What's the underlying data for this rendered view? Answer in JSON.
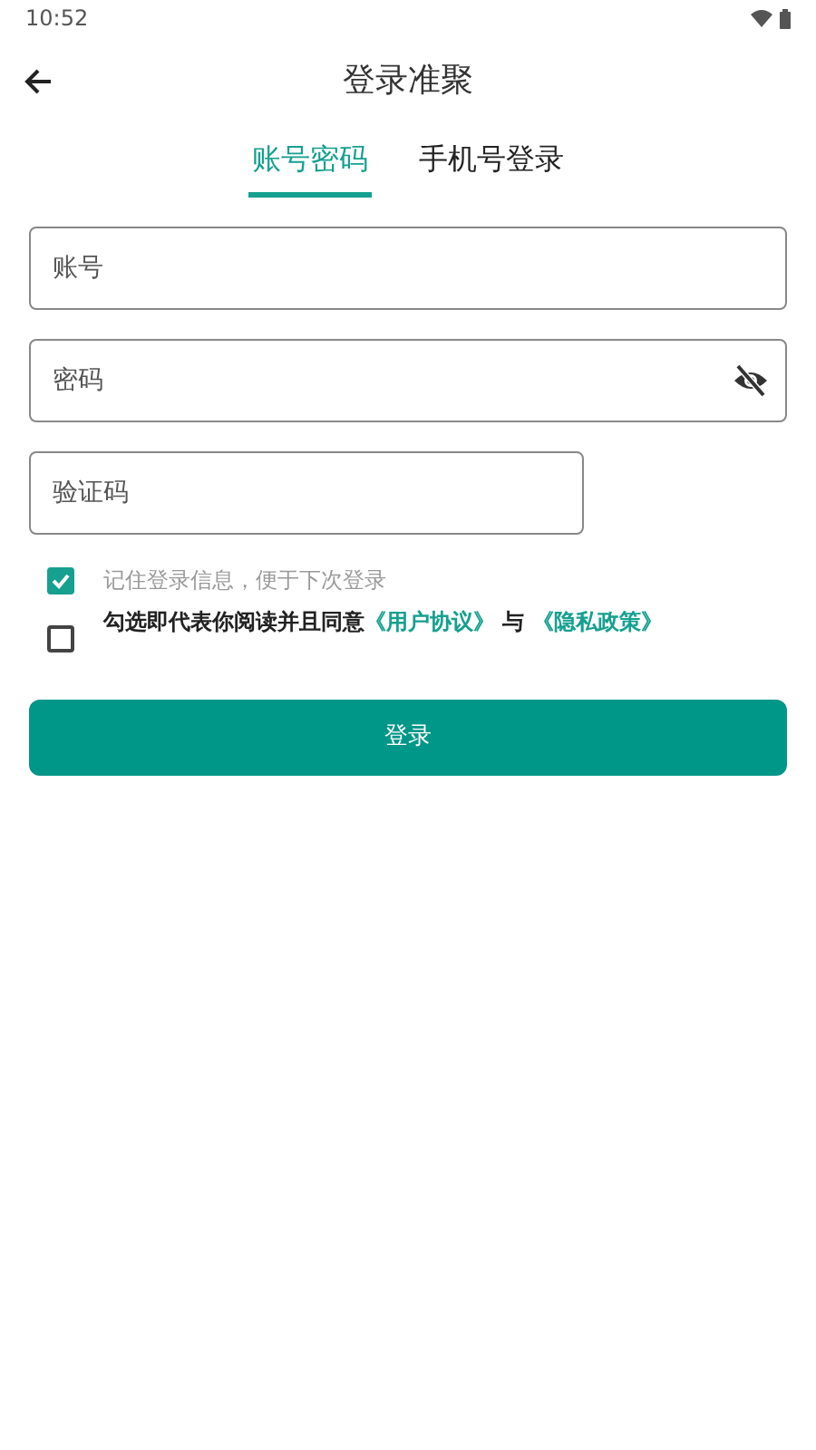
{
  "status_bar": {
    "time": "10:52"
  },
  "header": {
    "title": "登录准聚"
  },
  "tabs": [
    {
      "label": "账号密码",
      "selected": true
    },
    {
      "label": "手机号登录",
      "selected": false
    }
  ],
  "fields": [
    {
      "kind": "text",
      "placeholder": "账号"
    },
    {
      "kind": "password",
      "placeholder": "密码"
    },
    {
      "kind": "captcha",
      "placeholder": "验证码"
    }
  ],
  "remember": {
    "label": "记住登录信息，便于下次登录",
    "checked": true
  },
  "agreement": {
    "checked": false,
    "text": "勾选即代表你阅读并且同意",
    "link_1": "《用户协议》",
    "joiner": "与",
    "link_2": "《隐私政策》"
  },
  "login_button": "登录"
}
